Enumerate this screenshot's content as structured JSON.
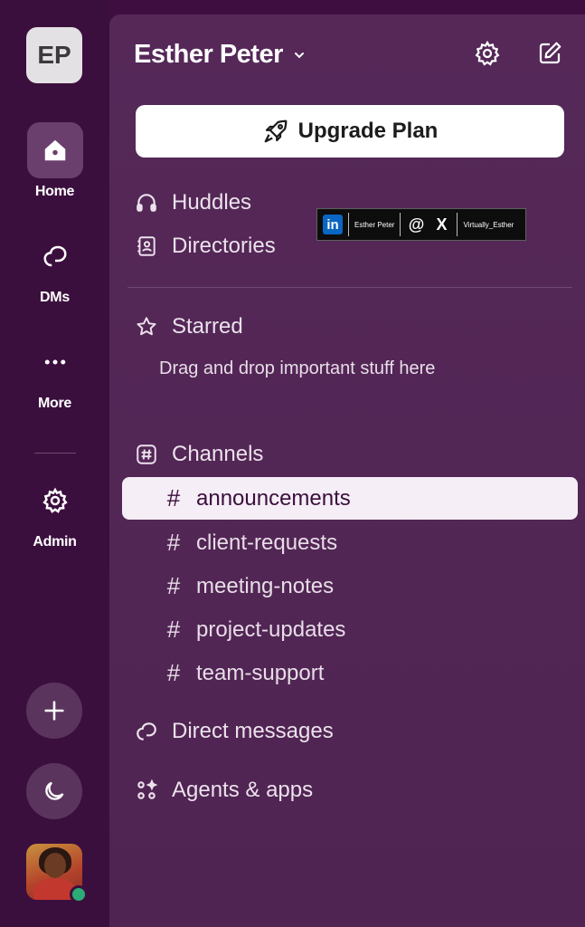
{
  "workspace": {
    "initials": "EP",
    "name": "Esther Peter"
  },
  "rail": {
    "items": [
      {
        "label": "Home",
        "icon": "home-icon",
        "active": true
      },
      {
        "label": "DMs",
        "icon": "dm-bubble-icon",
        "active": false
      },
      {
        "label": "More",
        "icon": "more-dots-icon",
        "active": false
      },
      {
        "label": "Admin",
        "icon": "gear-icon",
        "active": false
      }
    ],
    "add_icon": "plus-icon",
    "theme_icon": "moon-icon",
    "presence": "online"
  },
  "header": {
    "settings_icon": "gear-icon",
    "compose_icon": "compose-icon"
  },
  "upgrade": {
    "label": "Upgrade Plan",
    "icon": "rocket-icon"
  },
  "nav": {
    "huddles": "Huddles",
    "directories": "Directories",
    "starred": "Starred",
    "starred_hint": "Drag and drop important stuff here",
    "channels": "Channels",
    "direct_messages": "Direct messages",
    "agents_apps": "Agents & apps"
  },
  "channels": [
    {
      "name": "announcements",
      "active": true
    },
    {
      "name": "client-requests",
      "active": false
    },
    {
      "name": "meeting-notes",
      "active": false
    },
    {
      "name": "project-updates",
      "active": false
    },
    {
      "name": "team-support",
      "active": false
    }
  ],
  "channel_prefix": "#",
  "banner": {
    "linkedin": "in",
    "name": "Esther Peter",
    "threads": "@",
    "x": "X",
    "handle": "Virtually_Esther"
  },
  "colors": {
    "rail_bg": "#3b0f3d",
    "panel_bg": "#552858",
    "active_channel_bg": "#f5eef6",
    "presence_green": "#2bac76"
  }
}
